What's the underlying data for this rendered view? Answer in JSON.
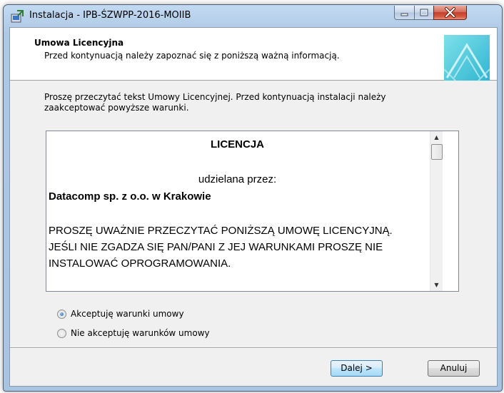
{
  "window": {
    "title": "Instalacja - IPB-ŚZWPP-2016-MOIIB",
    "icons": {
      "app": "installer-icon",
      "minimize": "minimize-icon",
      "maximize": "maximize-icon",
      "close": "close-icon"
    }
  },
  "header": {
    "title": "Umowa Licencyjna",
    "subtitle": "Przed kontynuacją należy zapoznać się z poniższą ważną informacją."
  },
  "intro": {
    "text": "Proszę przeczytać tekst Umowy Licencyjnej. Przed kontynuacją instalacji należy zaakceptować powyższe warunki."
  },
  "license": {
    "heading": "LICENCJA",
    "granted_by": "udzielana przez:",
    "company": "Datacomp sp. z o.o. w Krakowie",
    "line1": "PROSZĘ UWAŻNIE PRZECZYTAĆ PONIŻSZĄ UMOWĘ LICENCYJNĄ.",
    "line2": "JEŚLI NIE ZGADZA SIĘ PAN/PANI Z JEJ WARUNKAMI PROSZĘ NIE",
    "line3": "INSTALOWAĆ OPROGRAMOWANIA."
  },
  "options": {
    "accept": {
      "label": "Akceptuję warunki umowy",
      "selected": true
    },
    "decline": {
      "label": "Nie akceptuję warunków umowy",
      "selected": false
    }
  },
  "buttons": {
    "next": "Dalej >",
    "cancel": "Anuluj"
  },
  "colors": {
    "title_bar": "#b9d1ea",
    "logo_accent": "#3fc3d9",
    "close_button": "#c7402d"
  }
}
